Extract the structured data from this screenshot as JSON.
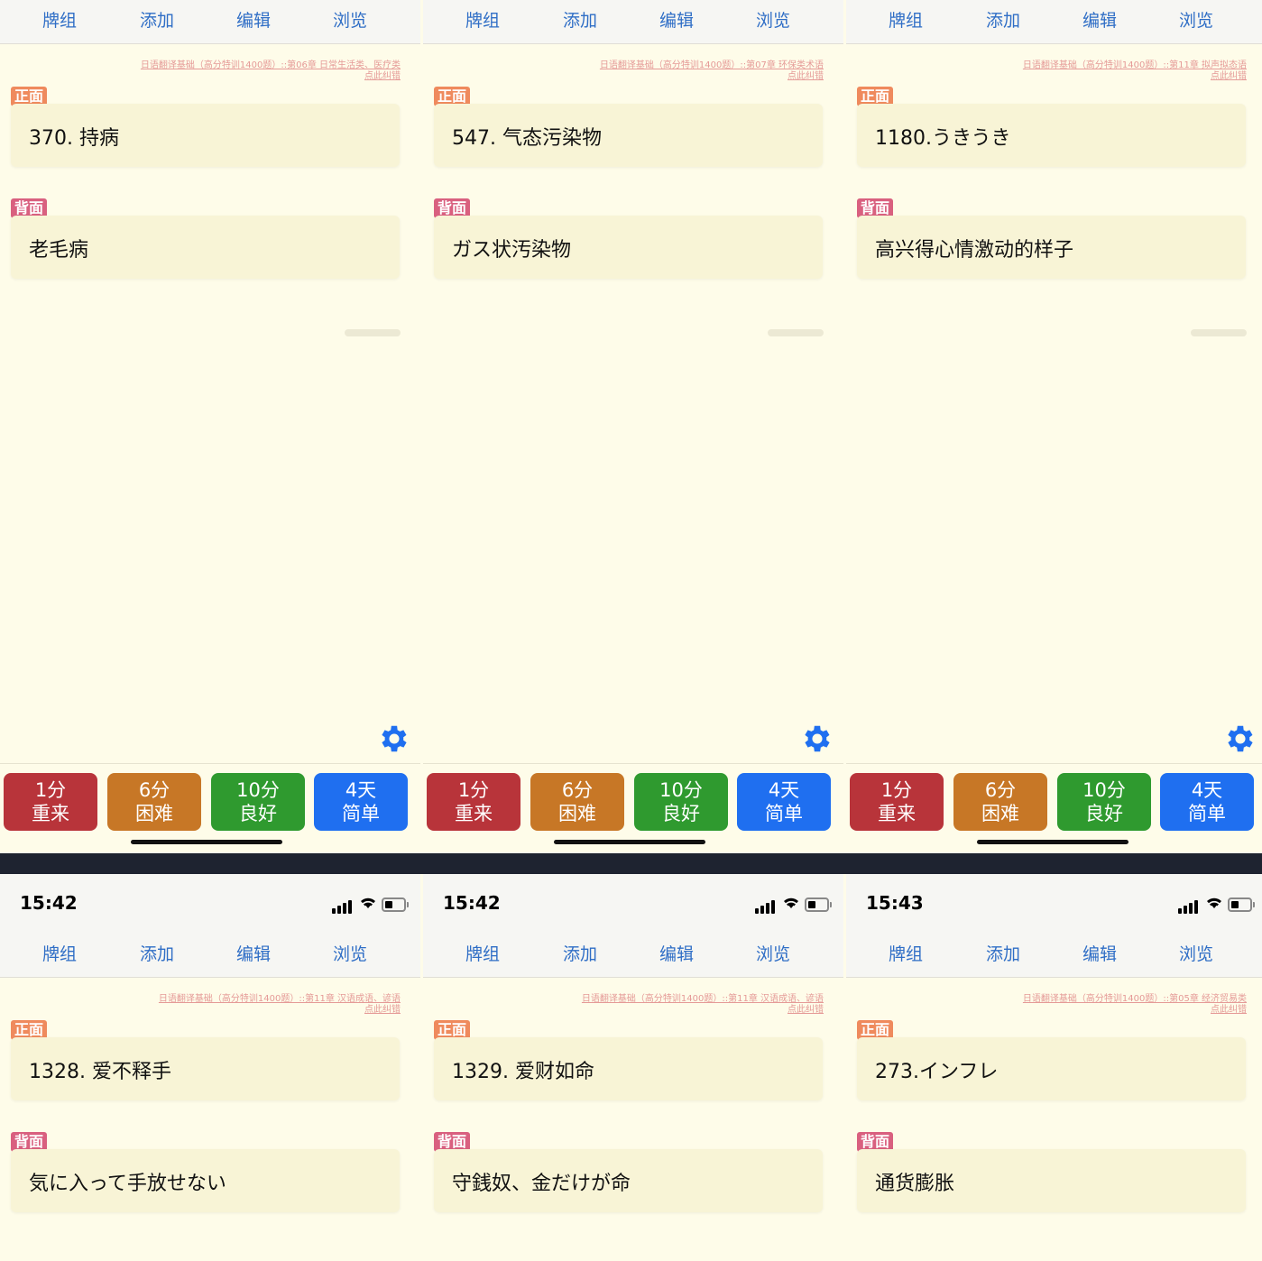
{
  "nav": [
    "牌组",
    "添加",
    "编辑",
    "浏览"
  ],
  "labels": {
    "front": "正面",
    "back": "背面"
  },
  "buttons": {
    "again": {
      "time": "1分",
      "label": "重来"
    },
    "hard": {
      "time": "6分",
      "label": "困难"
    },
    "good": {
      "time": "10分",
      "label": "良好"
    },
    "easy": {
      "time": "4天",
      "label": "简单"
    }
  },
  "colors": {
    "again": "#b8343a",
    "hard": "#c77726",
    "good": "#2f9a2f",
    "easy": "#1f6ff0",
    "accent": "#2f6ec6"
  },
  "icons": {
    "settings": "gear-icon",
    "signal": "cellular-signal-icon",
    "wifi": "wifi-icon",
    "battery": "battery-icon"
  },
  "panels": [
    {
      "source": "日语翻译基础（高分特训1400题）::第06章 日常生活类、医疗类",
      "source_link": "点此纠错",
      "front": "370.  持病",
      "back": "老毛病"
    },
    {
      "source": "日语翻译基础（高分特训1400题）::第07章 环保类术语",
      "source_link": "点此纠错",
      "front": "547.  气态污染物",
      "back": "ガス状汚染物"
    },
    {
      "source": "日语翻译基础（高分特训1400题）::第11章 拟声拟态语",
      "source_link": "点此纠错",
      "front": "1180.うきうき",
      "back": "高兴得心情激动的样子"
    },
    {
      "time": "15:42",
      "source": "日语翻译基础（高分特训1400题）::第11章 汉语成语、谚语",
      "source_link": "点此纠错",
      "front": "1328.  爱不释手",
      "back": "気に入って手放せない"
    },
    {
      "time": "15:42",
      "source": "日语翻译基础（高分特训1400题）::第11章 汉语成语、谚语",
      "source_link": "点此纠错",
      "front": "1329.  爱财如命",
      "back": "守銭奴、金だけが命"
    },
    {
      "time": "15:43",
      "source": "日语翻译基础（高分特训1400题）::第05章 经济贸易类",
      "source_link": "点此纠错",
      "front": "273.インフレ",
      "back": "通货膨胀"
    }
  ]
}
